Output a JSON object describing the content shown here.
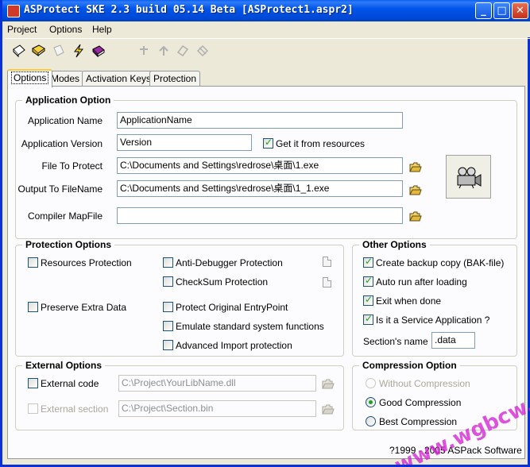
{
  "window": {
    "title": "ASProtect SKE 2.3 build 05.14 Beta [ASProtect1.aspr2]",
    "min_glyph": "_",
    "max_glyph": "□",
    "close_glyph": "✕"
  },
  "menu": {
    "items": [
      "Project",
      "Options",
      "Help"
    ]
  },
  "toolbar": {
    "icons": [
      "new-project-icon",
      "open-project-icon",
      "save-project-icon",
      "protect-icon",
      "help-book-icon",
      "move-up-icon",
      "move-down-icon",
      "add-icon",
      "remove-icon"
    ]
  },
  "tabs": [
    "Options",
    "Modes",
    "Activation Keys",
    "Protection"
  ],
  "application_option": {
    "title": "Application Option",
    "app_name_label": "Application Name",
    "app_name_value": "ApplicationName",
    "app_version_label": "Application Version",
    "app_version_value": "Version",
    "get_from_resources_label": "Get it from resources",
    "file_to_protect_label": "File To Protect",
    "file_to_protect_value": "C:\\Documents and Settings\\redrose\\桌面\\1.exe",
    "output_label": "Output To FileName",
    "output_value": "C:\\Documents and Settings\\redrose\\桌面\\1_1.exe",
    "mapfile_label": "Compiler MapFile",
    "mapfile_value": ""
  },
  "protection_options": {
    "title": "Protection Options",
    "resources_protection": "Resources Protection",
    "preserve_extra_data": "Preserve Extra Data",
    "anti_debugger": "Anti-Debugger Protection",
    "checksum": "CheckSum Protection",
    "protect_entry": "Protect Original EntryPoint",
    "emulate_functions": "Emulate standard system functions",
    "advanced_import": "Advanced Import protection"
  },
  "other_options": {
    "title": "Other Options",
    "backup": "Create backup copy (BAK-file)",
    "auto_run": "Auto run after loading",
    "exit_when_done": "Exit when done",
    "service_app": "Is it a Service Application ?",
    "section_name_label": "Section's name :",
    "section_name_value": ".data"
  },
  "external_options": {
    "title": "External Options",
    "external_code": "External code",
    "external_code_path": "C:\\Project\\YourLibName.dll",
    "external_section": "External section",
    "external_section_path": "C:\\Project\\Section.bin"
  },
  "compression_option": {
    "title": "Compression Option",
    "without": "Without Compression",
    "good": "Good Compression",
    "best": "Best Compression"
  },
  "footer": {
    "copyright": "?1999 - 2005 ASPack Software"
  },
  "watermark": {
    "text": "www.wgbcw.com"
  },
  "colors": {
    "titlebar": "#0055ea",
    "check": "#21a121",
    "dialog_bg": "#ece9d8",
    "panel_bg": "#fcfcfe"
  }
}
